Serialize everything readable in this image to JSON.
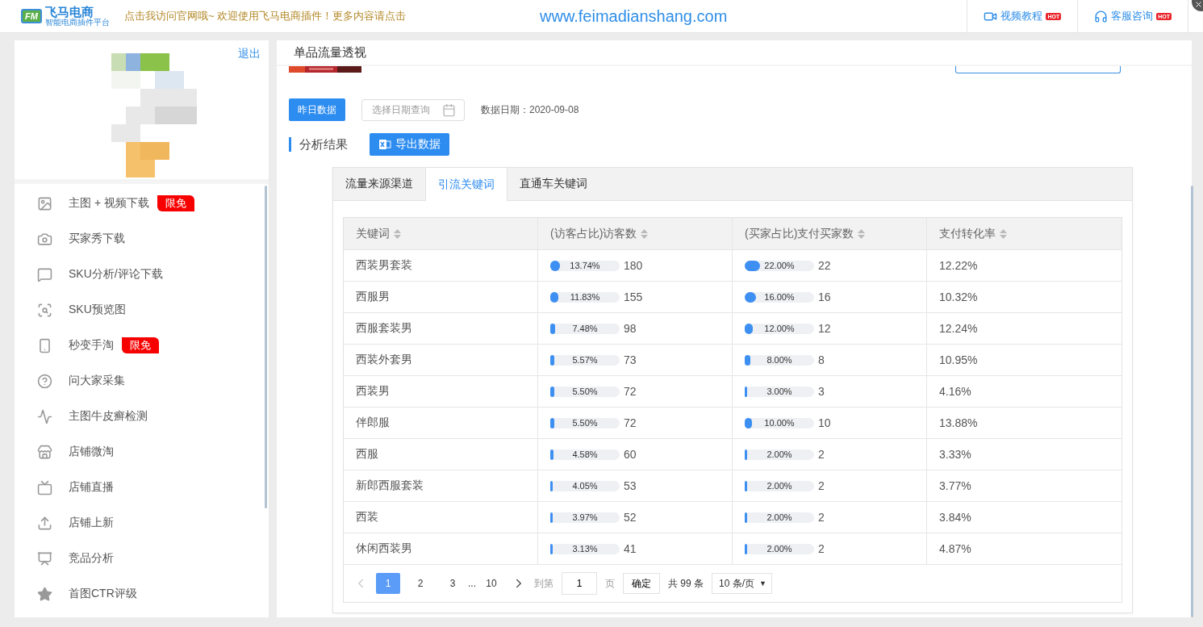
{
  "topbar": {
    "logo_mark": "FM",
    "logo_text": "飞马电商",
    "logo_subtitle": "智能电商插件平台",
    "notice": "点击我访问官网哦~ 欢迎使用飞马电商插件！更多内容请点击",
    "url": "www.feimadianshang.com",
    "links": [
      {
        "label": "视频教程",
        "badge": "HOT"
      },
      {
        "label": "客服咨询",
        "badge": "HOT"
      }
    ]
  },
  "sidebar": {
    "logout": "退出",
    "items": [
      {
        "label": "主图 + 视频下载",
        "badge": "限免"
      },
      {
        "label": "买家秀下载"
      },
      {
        "label": "SKU分析/评论下载"
      },
      {
        "label": "SKU预览图"
      },
      {
        "label": "秒变手淘",
        "badge": "限免"
      },
      {
        "label": "问大家采集"
      },
      {
        "label": "主图牛皮癣检测"
      },
      {
        "label": "店铺微淘"
      },
      {
        "label": "店铺直播"
      },
      {
        "label": "店铺上新"
      },
      {
        "label": "竞品分析"
      },
      {
        "label": "首图CTR评级"
      }
    ]
  },
  "panel": {
    "title": "单品流量透视",
    "yesterday_button": "昨日数据",
    "date_picker": {
      "placeholder": "选择日期查询"
    },
    "data_date": "数据日期：2020-09-08",
    "section_title": "分析结果",
    "export_button": "导出数据",
    "tabs": [
      {
        "label": "流量来源渠道",
        "selected": false
      },
      {
        "label": "引流关键词",
        "selected": true
      },
      {
        "label": "直通车关键词",
        "selected": false
      }
    ],
    "table": {
      "columns": [
        "关键词",
        "(访客占比)访客数",
        "(买家占比)支付买家数",
        "支付转化率"
      ],
      "rows": [
        {
          "keyword": "西装男套装",
          "visitor_share": {
            "level": 0.1374,
            "reading": "13.74%"
          },
          "visitors": "180",
          "buyer_share": {
            "level": 0.22,
            "reading": "22.00%"
          },
          "buyers": "22",
          "conversion": "12.22%"
        },
        {
          "keyword": "西服男",
          "visitor_share": {
            "level": 0.1183,
            "reading": "11.83%"
          },
          "visitors": "155",
          "buyer_share": {
            "level": 0.16,
            "reading": "16.00%"
          },
          "buyers": "16",
          "conversion": "10.32%"
        },
        {
          "keyword": "西服套装男",
          "visitor_share": {
            "level": 0.0748,
            "reading": "7.48%"
          },
          "visitors": "98",
          "buyer_share": {
            "level": 0.12,
            "reading": "12.00%"
          },
          "buyers": "12",
          "conversion": "12.24%"
        },
        {
          "keyword": "西装外套男",
          "visitor_share": {
            "level": 0.0557,
            "reading": "5.57%"
          },
          "visitors": "73",
          "buyer_share": {
            "level": 0.08,
            "reading": "8.00%"
          },
          "buyers": "8",
          "conversion": "10.95%"
        },
        {
          "keyword": "西装男",
          "visitor_share": {
            "level": 0.055,
            "reading": "5.50%"
          },
          "visitors": "72",
          "buyer_share": {
            "level": 0.03,
            "reading": "3.00%"
          },
          "buyers": "3",
          "conversion": "4.16%"
        },
        {
          "keyword": "伴郎服",
          "visitor_share": {
            "level": 0.055,
            "reading": "5.50%"
          },
          "visitors": "72",
          "buyer_share": {
            "level": 0.1,
            "reading": "10.00%"
          },
          "buyers": "10",
          "conversion": "13.88%"
        },
        {
          "keyword": "西服",
          "visitor_share": {
            "level": 0.0458,
            "reading": "4.58%"
          },
          "visitors": "60",
          "buyer_share": {
            "level": 0.02,
            "reading": "2.00%"
          },
          "buyers": "2",
          "conversion": "3.33%"
        },
        {
          "keyword": "新郎西服套装",
          "visitor_share": {
            "level": 0.0405,
            "reading": "4.05%"
          },
          "visitors": "53",
          "buyer_share": {
            "level": 0.02,
            "reading": "2.00%"
          },
          "buyers": "2",
          "conversion": "3.77%"
        },
        {
          "keyword": "西装",
          "visitor_share": {
            "level": 0.0397,
            "reading": "3.97%"
          },
          "visitors": "52",
          "buyer_share": {
            "level": 0.02,
            "reading": "2.00%"
          },
          "buyers": "2",
          "conversion": "3.84%"
        },
        {
          "keyword": "休闲西装男",
          "visitor_share": {
            "level": 0.0313,
            "reading": "3.13%"
          },
          "visitors": "41",
          "buyer_share": {
            "level": 0.02,
            "reading": "2.00%"
          },
          "buyers": "2",
          "conversion": "4.87%"
        }
      ]
    },
    "pagination": {
      "pages": [
        {
          "label": "1",
          "selected": true
        },
        {
          "label": "2",
          "selected": false
        },
        {
          "label": "3",
          "selected": false
        }
      ],
      "ellipsis": "...",
      "last_page": {
        "label": "10",
        "selected": false
      },
      "page_size_caret": "▼",
      "goto_label": "到第",
      "goto_value": "1",
      "page_suffix": "页",
      "confirm": "确定",
      "total": "共 99 条",
      "page_size": "10 条/页"
    }
  }
}
